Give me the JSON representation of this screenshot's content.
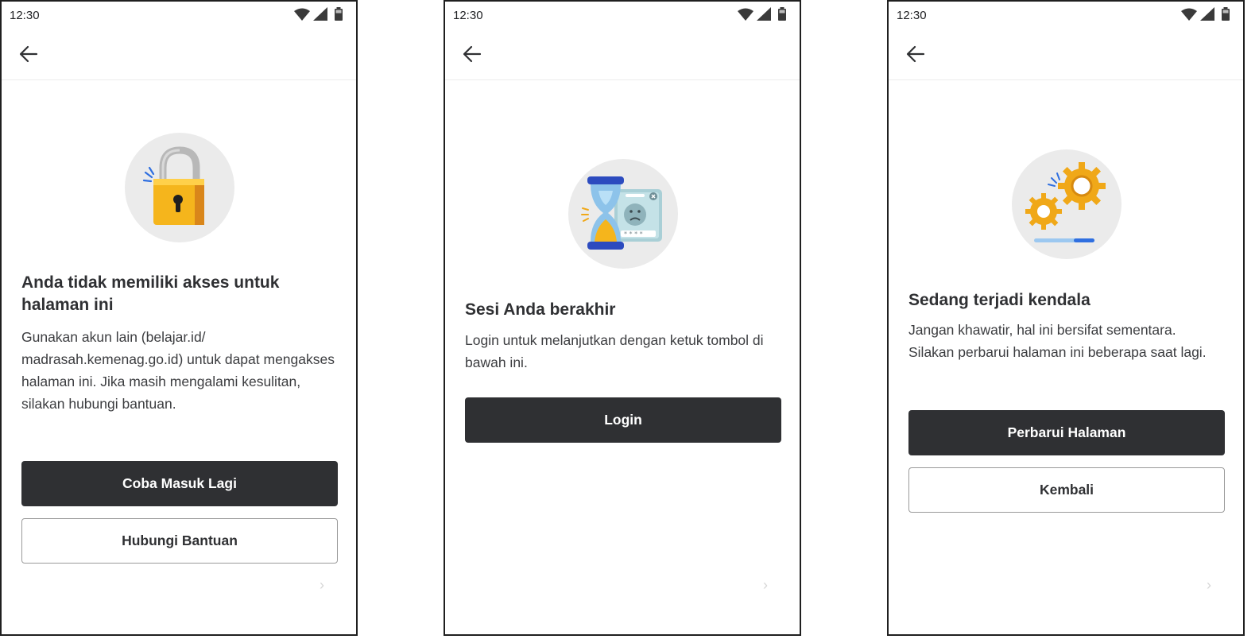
{
  "screens": [
    {
      "status_time": "12:30",
      "illustration_icon": "padlock-icon",
      "title": "Anda tidak memiliki akses untuk halaman ini",
      "description": "Gunakan akun lain (belajar.id/ madrasah.kemenag.go.id) untuk dapat mengakses halaman ini. Jika masih mengalami kesulitan, silakan hubungi bantuan.",
      "primary_button": "Coba Masuk Lagi",
      "secondary_button": "Hubungi Bantuan"
    },
    {
      "status_time": "12:30",
      "illustration_icon": "hourglass-session-icon",
      "title": "Sesi Anda berakhir",
      "description": "Login untuk melanjutkan dengan ketuk tombol di bawah ini.",
      "primary_button": "Login"
    },
    {
      "status_time": "12:30",
      "illustration_icon": "gears-icon",
      "title": "Sedang terjadi kendala",
      "description": "Jangan khawatir, hal ini bersifat sementara. Silakan perbarui halaman ini beberapa saat lagi.",
      "primary_button": "Perbarui Halaman",
      "secondary_button": "Kembali"
    }
  ],
  "colors": {
    "primary_button": "#2f3033",
    "text": "#2f3033",
    "illustration_bg": "#ebebeb",
    "lock_gold": "#f5b51c",
    "gear_gold": "#f0a818",
    "accent_blue": "#2f6fe0"
  }
}
